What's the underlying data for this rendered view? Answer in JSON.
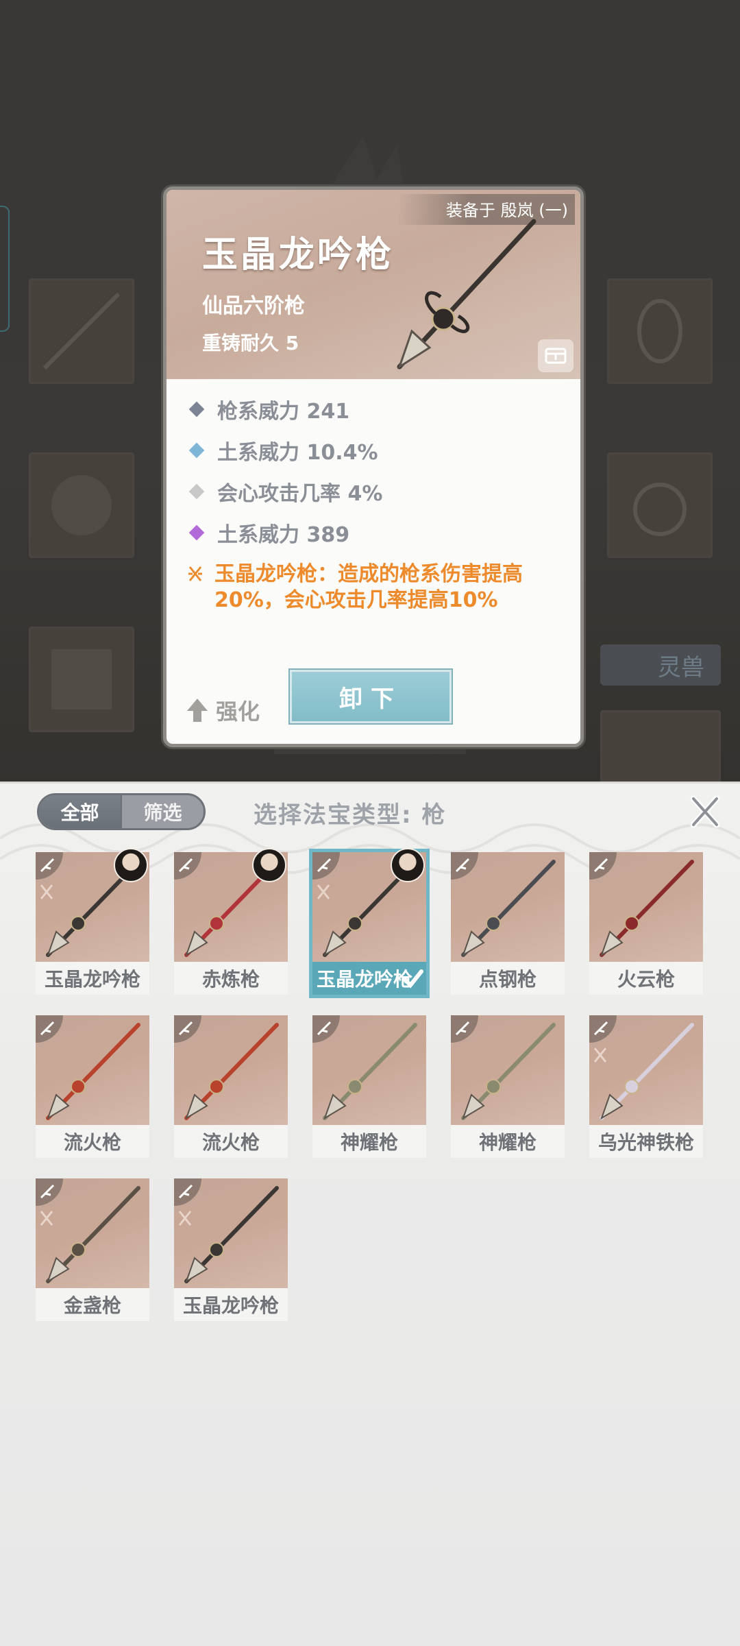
{
  "detail_card": {
    "equipped_label": "装备于 殷岚 (一)",
    "title": "玉晶龙吟枪",
    "grade": "仙品六阶枪",
    "reforge": "重铸耐久 5",
    "stats": [
      {
        "text": "枪系威力 241",
        "color": "#7a8494"
      },
      {
        "text": "土系威力 10.4%",
        "color": "#7fb6d8"
      },
      {
        "text": "会心攻击几率 4%",
        "color": "#c8c8c8"
      },
      {
        "text": "土系威力 389",
        "color": "#b26ad8"
      }
    ],
    "special_effect": "玉晶龙吟枪：造成的枪系伤害提高20%，会心攻击几率提高10%",
    "upgrade_label": "强化",
    "unequip_label": "卸下"
  },
  "background": {
    "beast_tab_label": "灵兽"
  },
  "panel": {
    "filter_all": "全部",
    "filter_screen": "筛选",
    "title": "选择法宝类型: 枪",
    "items": [
      {
        "name": "玉晶龙吟枪",
        "equipped_by_avatar": true,
        "selected": false,
        "special": true,
        "color": "#3a3634"
      },
      {
        "name": "赤炼枪",
        "equipped_by_avatar": true,
        "selected": false,
        "special": false,
        "color": "#b0343a"
      },
      {
        "name": "玉晶龙吟枪",
        "equipped_by_avatar": true,
        "selected": true,
        "special": true,
        "color": "#3a3634"
      },
      {
        "name": "点钢枪",
        "equipped_by_avatar": false,
        "selected": false,
        "special": false,
        "color": "#4a4c52"
      },
      {
        "name": "火云枪",
        "equipped_by_avatar": false,
        "selected": false,
        "special": false,
        "color": "#8a2a2a"
      },
      {
        "name": "流火枪",
        "equipped_by_avatar": false,
        "selected": false,
        "special": false,
        "color": "#b8422c"
      },
      {
        "name": "流火枪",
        "equipped_by_avatar": false,
        "selected": false,
        "special": false,
        "color": "#b8422c"
      },
      {
        "name": "神耀枪",
        "equipped_by_avatar": false,
        "selected": false,
        "special": false,
        "color": "#8a8a70"
      },
      {
        "name": "神耀枪",
        "equipped_by_avatar": false,
        "selected": false,
        "special": false,
        "color": "#8a8a70"
      },
      {
        "name": "乌光神铁枪",
        "equipped_by_avatar": false,
        "selected": false,
        "special": true,
        "color": "#d8d0dc"
      },
      {
        "name": "金盏枪",
        "equipped_by_avatar": false,
        "selected": false,
        "special": true,
        "color": "#5a5046"
      },
      {
        "name": "玉晶龙吟枪",
        "equipped_by_avatar": false,
        "selected": false,
        "special": true,
        "color": "#3a3634"
      }
    ]
  }
}
